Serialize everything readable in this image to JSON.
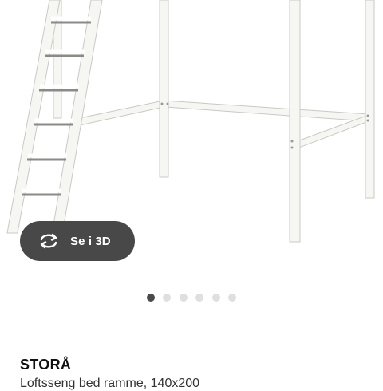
{
  "gallery": {
    "image_alt": "STORÅ loft bed frame, white",
    "view_3d_label": "Se i 3D",
    "view_3d_icon": "rotate-3d-icon",
    "dots_count": 6,
    "active_dot": 0
  },
  "product": {
    "name": "STORÅ",
    "description": "Loftsseng bed ramme, 140x200"
  },
  "colors": {
    "button_bg": "#484848",
    "dot_active": "#4a4a4a",
    "dot_inactive": "#dfdfdf",
    "frame": "#f4f4f2"
  }
}
